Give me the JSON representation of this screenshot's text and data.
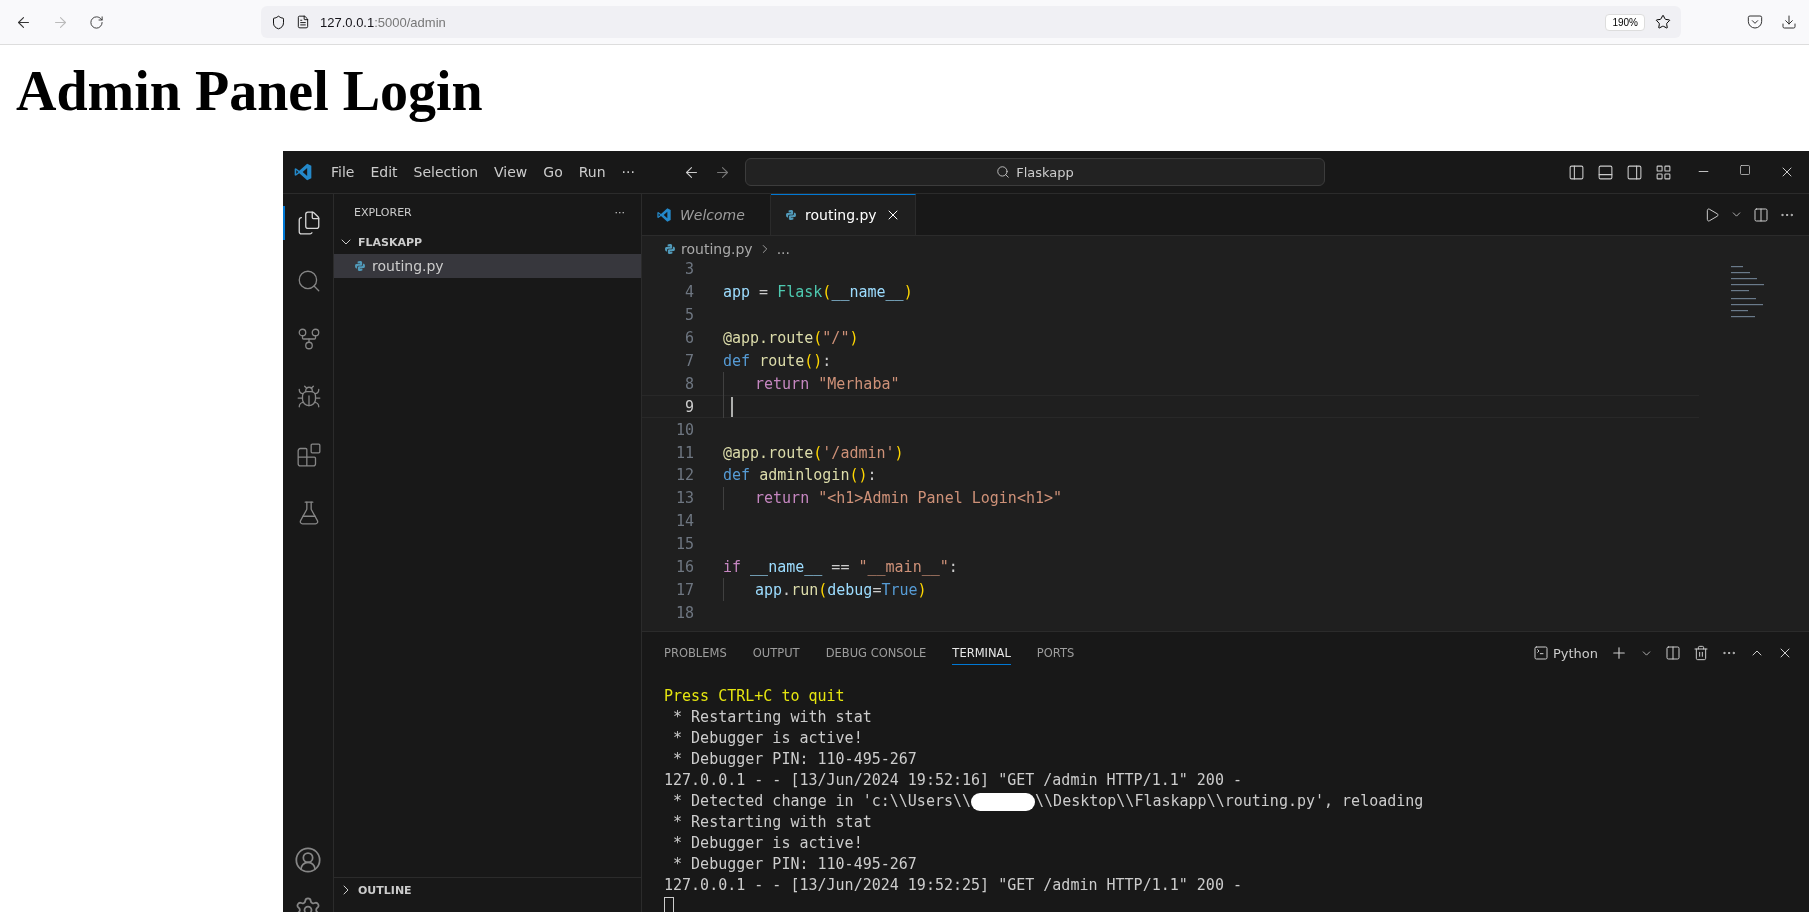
{
  "browser": {
    "url_host": "127.0.0.1",
    "url_rest": ":5000/admin",
    "zoom": "190%",
    "forward_disabled": true
  },
  "page": {
    "heading": "Admin Panel Login"
  },
  "vscode": {
    "menu": [
      "File",
      "Edit",
      "Selection",
      "View",
      "Go",
      "Run",
      "···"
    ],
    "search": "Flaskapp",
    "activity": [
      {
        "kind": "files",
        "selected": true
      },
      {
        "kind": "search",
        "selected": false
      },
      {
        "kind": "git",
        "selected": false
      },
      {
        "kind": "debug",
        "selected": false
      },
      {
        "kind": "extensions",
        "selected": false
      },
      {
        "kind": "testing",
        "selected": false
      }
    ],
    "sidebar": {
      "title": "EXPLORER",
      "more": "···",
      "folder": "FLASKAPP",
      "folder_expanded": true,
      "files": [
        {
          "name": "routing.py",
          "selected": true
        }
      ],
      "outline": "OUTLINE",
      "outline_expanded": false
    },
    "tabs": [
      {
        "label": "Welcome",
        "kind": "welcome",
        "selected": false
      },
      {
        "label": "routing.py",
        "kind": "python",
        "selected": true
      }
    ],
    "breadcrumb": {
      "file": "routing.py",
      "rest": "..."
    },
    "code": [
      {
        "number": "3",
        "current": false,
        "indent": false
      },
      {
        "number": "4",
        "current": false,
        "indent": false,
        "tokens": [
          {
            "text": "app",
            "kind": "var"
          },
          {
            "text": " = ",
            "kind": "op"
          },
          {
            "text": "Flask",
            "kind": "class"
          },
          {
            "text": "(",
            "kind": "paren"
          },
          {
            "text": "__name__",
            "kind": "var"
          },
          {
            "text": ")",
            "kind": "paren"
          }
        ]
      },
      {
        "number": "5",
        "current": false,
        "indent": false
      },
      {
        "number": "6",
        "current": false,
        "indent": false,
        "tokens": [
          {
            "text": "@app.route",
            "kind": "func"
          },
          {
            "text": "(",
            "kind": "paren"
          },
          {
            "text": "\"/\"",
            "kind": "str"
          },
          {
            "text": ")",
            "kind": "paren"
          }
        ]
      },
      {
        "number": "7",
        "current": false,
        "indent": false,
        "tokens": [
          {
            "text": "def ",
            "kind": "keyword"
          },
          {
            "text": "route",
            "kind": "func"
          },
          {
            "text": "()",
            "kind": "paren"
          },
          {
            "text": ":",
            "kind": "op"
          }
        ]
      },
      {
        "number": "8",
        "current": false,
        "indent": true,
        "tokens": [
          {
            "text": "return ",
            "kind": "control"
          },
          {
            "text": "\"Merhaba\"",
            "kind": "str"
          }
        ]
      },
      {
        "number": "9",
        "current": true,
        "indent": true
      },
      {
        "number": "10",
        "current": false,
        "indent": false
      },
      {
        "number": "11",
        "current": false,
        "indent": false,
        "tokens": [
          {
            "text": "@app.route",
            "kind": "func"
          },
          {
            "text": "(",
            "kind": "paren"
          },
          {
            "text": "'/admin'",
            "kind": "str"
          },
          {
            "text": ")",
            "kind": "paren"
          }
        ]
      },
      {
        "number": "12",
        "current": false,
        "indent": false,
        "tokens": [
          {
            "text": "def ",
            "kind": "keyword"
          },
          {
            "text": "adminlogin",
            "kind": "func"
          },
          {
            "text": "()",
            "kind": "paren"
          },
          {
            "text": ":",
            "kind": "op"
          }
        ]
      },
      {
        "number": "13",
        "current": false,
        "indent": true,
        "tokens": [
          {
            "text": "return ",
            "kind": "control"
          },
          {
            "text": "\"<h1>Admin Panel Login<h1>\"",
            "kind": "str"
          }
        ]
      },
      {
        "number": "14",
        "current": false,
        "indent": false
      },
      {
        "number": "15",
        "current": false,
        "indent": false
      },
      {
        "number": "16",
        "current": false,
        "indent": false,
        "tokens": [
          {
            "text": "if ",
            "kind": "control"
          },
          {
            "text": "__name__",
            "kind": "var"
          },
          {
            "text": " == ",
            "kind": "op"
          },
          {
            "text": "\"__main__\"",
            "kind": "str"
          },
          {
            "text": ":",
            "kind": "op"
          }
        ]
      },
      {
        "number": "17",
        "current": false,
        "indent": true,
        "tokens": [
          {
            "text": "app",
            "kind": "var"
          },
          {
            "text": ".",
            "kind": "op"
          },
          {
            "text": "run",
            "kind": "func"
          },
          {
            "text": "(",
            "kind": "paren"
          },
          {
            "text": "debug",
            "kind": "var"
          },
          {
            "text": "=",
            "kind": "op"
          },
          {
            "text": "True",
            "kind": "keyword"
          },
          {
            "text": ")",
            "kind": "paren"
          }
        ]
      },
      {
        "number": "18",
        "current": false,
        "indent": false
      }
    ],
    "panel_tabs": [
      {
        "label": "PROBLEMS",
        "selected": false
      },
      {
        "label": "OUTPUT",
        "selected": false
      },
      {
        "label": "DEBUG CONSOLE",
        "selected": false
      },
      {
        "label": "TERMINAL",
        "selected": true
      },
      {
        "label": "PORTS",
        "selected": false
      }
    ],
    "terminal_name": "Python",
    "terminal": [
      {
        "kind": "warning",
        "text": "Press CTRL+C to quit"
      },
      {
        "kind": "plain",
        "text": " * Restarting with stat"
      },
      {
        "kind": "plain",
        "text": " * Debugger is active!"
      },
      {
        "kind": "plain",
        "text": " * Debugger PIN: 110-495-267"
      },
      {
        "kind": "plain",
        "text": "127.0.0.1 - - [13/Jun/2024 19:52:16] \"GET /admin HTTP/1.1\" 200 -"
      },
      {
        "kind": "redacted",
        "text": " * Detected change in 'c:\\\\Users\\\\",
        "text_after": "\\\\Desktop\\\\Flaskapp\\\\routing.py', reloading"
      },
      {
        "kind": "plain",
        "text": " * Restarting with stat"
      },
      {
        "kind": "plain",
        "text": " * Debugger is active!"
      },
      {
        "kind": "plain",
        "text": " * Debugger PIN: 110-495-267"
      },
      {
        "kind": "plain",
        "text": "127.0.0.1 - - [13/Jun/2024 19:52:25] \"GET /admin HTTP/1.1\" 200 -"
      },
      {
        "kind": "cursor"
      }
    ]
  }
}
